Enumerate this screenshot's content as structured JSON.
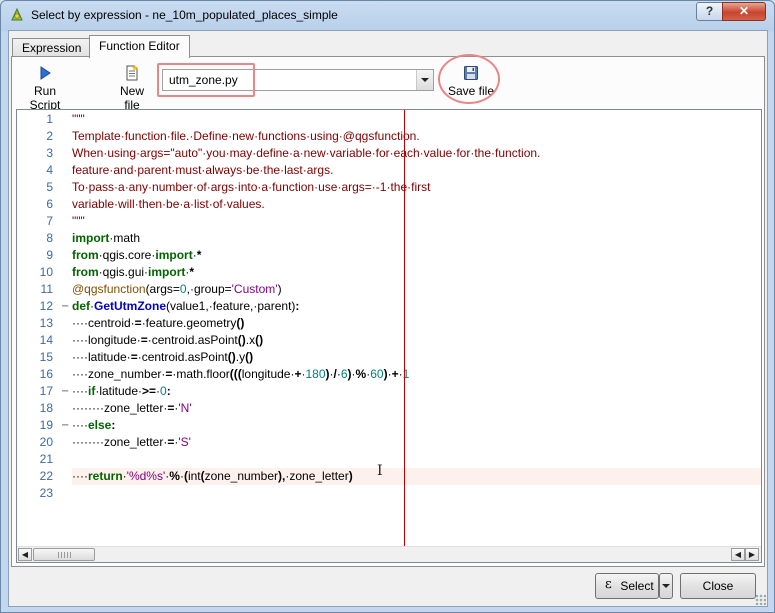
{
  "window": {
    "title": "Select by expression - ne_10m_populated_places_simple",
    "help_label": "?",
    "close_label": "✕"
  },
  "tabs": [
    {
      "label": "Expression",
      "active": false
    },
    {
      "label": "Function Editor",
      "active": true
    }
  ],
  "toolbar": {
    "run_script_label": "Run Script",
    "new_file_label": "New file",
    "save_file_label": "Save file",
    "current_file": "utm_zone.py"
  },
  "editor": {
    "current_line": 22,
    "line_numbers": [
      "1",
      "2",
      "3",
      "4",
      "5",
      "6",
      "7",
      "8",
      "9",
      "10",
      "11",
      "12",
      "13",
      "14",
      "15",
      "16",
      "17",
      "18",
      "19",
      "20",
      "21",
      "22",
      "23"
    ],
    "fold_markers": {
      "12": "−",
      "17": "−",
      "19": "−"
    },
    "lines": [
      [
        [
          "doc",
          "\"\"\""
        ]
      ],
      [
        [
          "doc",
          "Template·function·file.·Define·new·functions·using·@qgsfunction."
        ]
      ],
      [
        [
          "doc",
          "When·using·args=\"auto\"·you·may·define·a·new·variable·for·each·value·for·the·function."
        ]
      ],
      [
        [
          "doc",
          "feature·and·parent·must·always·be·the·last·args."
        ]
      ],
      [
        [
          "doc",
          "To·pass·a·any·number·of·args·into·a·function·use·args=·-1·the·first"
        ]
      ],
      [
        [
          "doc",
          "variable·will·then·be·a·list·of·values."
        ]
      ],
      [
        [
          "doc",
          "\"\"\""
        ]
      ],
      [
        [
          "kw",
          "import"
        ],
        [
          "plain",
          "·math"
        ]
      ],
      [
        [
          "kw",
          "from"
        ],
        [
          "plain",
          "·qgis.core·"
        ],
        [
          "kw",
          "import"
        ],
        [
          "plain",
          "·"
        ],
        [
          "bold",
          "*"
        ]
      ],
      [
        [
          "kw",
          "from"
        ],
        [
          "plain",
          "·qgis.gui·"
        ],
        [
          "kw",
          "import"
        ],
        [
          "plain",
          "·"
        ],
        [
          "bold",
          "*"
        ]
      ],
      [
        [
          "dec",
          "@qgsfunction"
        ],
        [
          "plain",
          "(args="
        ],
        [
          "num",
          "0"
        ],
        [
          "plain",
          ",·group="
        ],
        [
          "str",
          "'Custom'"
        ],
        [
          "plain",
          ")"
        ]
      ],
      [
        [
          "kw",
          "def"
        ],
        [
          "plain",
          "·"
        ],
        [
          "def",
          "GetUtmZone"
        ],
        [
          "plain",
          "(value1,·feature,·parent)"
        ],
        [
          "bold",
          ":"
        ]
      ],
      [
        [
          "plain",
          "····centroid·"
        ],
        [
          "bold",
          "="
        ],
        [
          "plain",
          "·feature.geometry"
        ],
        [
          "bold",
          "()"
        ]
      ],
      [
        [
          "plain",
          "····longitude·"
        ],
        [
          "bold",
          "="
        ],
        [
          "plain",
          "·centroid.asPoint"
        ],
        [
          "bold",
          "()"
        ],
        [
          "plain",
          ".x"
        ],
        [
          "bold",
          "()"
        ]
      ],
      [
        [
          "plain",
          "····latitude·"
        ],
        [
          "bold",
          "="
        ],
        [
          "plain",
          "·centroid.asPoint"
        ],
        [
          "bold",
          "()"
        ],
        [
          "plain",
          ".y"
        ],
        [
          "bold",
          "()"
        ]
      ],
      [
        [
          "plain",
          "····zone_number·"
        ],
        [
          "bold",
          "="
        ],
        [
          "plain",
          "·math.floor"
        ],
        [
          "bold",
          "((("
        ],
        [
          "plain",
          "longitude·"
        ],
        [
          "bold",
          "+"
        ],
        [
          "plain",
          "·"
        ],
        [
          "num",
          "180"
        ],
        [
          "bold",
          ")"
        ],
        [
          "plain",
          "·"
        ],
        [
          "bold",
          "/"
        ],
        [
          "plain",
          "·"
        ],
        [
          "num",
          "6"
        ],
        [
          "bold",
          ")"
        ],
        [
          "plain",
          "·"
        ],
        [
          "bold",
          "%"
        ],
        [
          "plain",
          "·"
        ],
        [
          "num",
          "60"
        ],
        [
          "bold",
          ")"
        ],
        [
          "plain",
          "·"
        ],
        [
          "bold",
          "+"
        ],
        [
          "plain",
          "·"
        ],
        [
          "num",
          "1"
        ]
      ],
      [
        [
          "plain",
          "····"
        ],
        [
          "kw",
          "if"
        ],
        [
          "plain",
          "·latitude·"
        ],
        [
          "bold",
          ">="
        ],
        [
          "plain",
          "·"
        ],
        [
          "num",
          "0"
        ],
        [
          "bold",
          ":"
        ]
      ],
      [
        [
          "plain",
          "········zone_letter·"
        ],
        [
          "bold",
          "="
        ],
        [
          "plain",
          "·"
        ],
        [
          "str",
          "'N'"
        ]
      ],
      [
        [
          "plain",
          "····"
        ],
        [
          "kw",
          "else"
        ],
        [
          "bold",
          ":"
        ]
      ],
      [
        [
          "plain",
          "········zone_letter·"
        ],
        [
          "bold",
          "="
        ],
        [
          "plain",
          "·"
        ],
        [
          "str",
          "'S'"
        ]
      ],
      [],
      [
        [
          "plain",
          "····"
        ],
        [
          "kw",
          "return"
        ],
        [
          "plain",
          "·"
        ],
        [
          "str",
          "'%d%s'"
        ],
        [
          "plain",
          "·"
        ],
        [
          "bold",
          "%"
        ],
        [
          "plain",
          "·"
        ],
        [
          "bold",
          "("
        ],
        [
          "plain",
          "int"
        ],
        [
          "bold",
          "("
        ],
        [
          "plain",
          "zone_number"
        ],
        [
          "bold",
          "),"
        ],
        [
          "plain",
          "·zone_letter"
        ],
        [
          "bold",
          ")"
        ]
      ],
      []
    ]
  },
  "buttons": {
    "select_label": "Select",
    "close_label": "Close"
  },
  "colors": {
    "docstring": "#7f0000",
    "keyword": "#006400",
    "function_name": "#0000c8",
    "string": "#7f007f",
    "number": "#007f7f",
    "decorator": "#805000",
    "edge_line": "#c00000",
    "highlight_annotation": "#e9868a"
  }
}
